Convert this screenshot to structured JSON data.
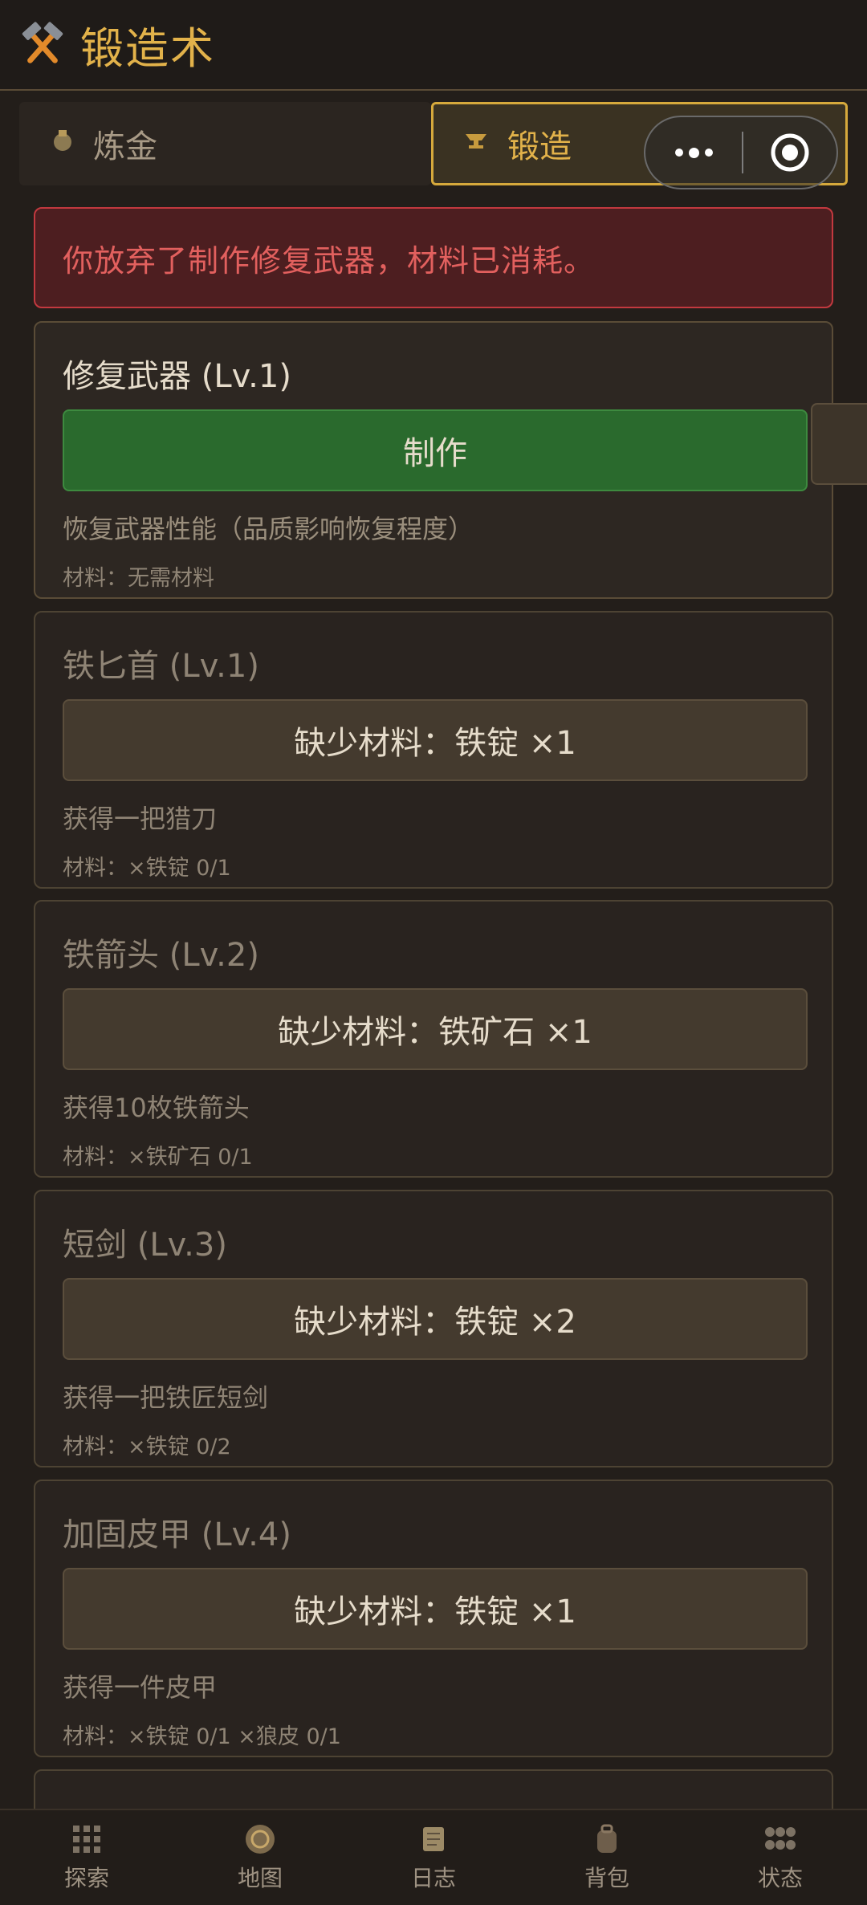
{
  "header": {
    "title": "锻造术",
    "logo_icon": "crossed-hammers-icon"
  },
  "tabs": [
    {
      "label": "炼金",
      "icon": "alchemy-icon",
      "active": false
    },
    {
      "label": "锻造",
      "icon": "anvil-icon",
      "active": true
    }
  ],
  "alert": {
    "text": "你放弃了制作修复武器，材料已消耗。"
  },
  "recipes": [
    {
      "title": "修复武器 (Lv.1)",
      "button": "制作",
      "desc": "恢复武器性能（品质影响恢复程度）",
      "materials": "材料：无需材料"
    },
    {
      "title": "铁匕首 (Lv.1)",
      "button": "缺少材料：铁锭 ×1",
      "desc": "获得一把猎刀",
      "materials": "材料：×铁锭 0/1"
    },
    {
      "title": "铁箭头 (Lv.2)",
      "button": "缺少材料：铁矿石 ×1",
      "desc": "获得10枚铁箭头",
      "materials": "材料：×铁矿石 0/1"
    },
    {
      "title": "短剑 (Lv.3)",
      "button": "缺少材料：铁锭 ×2",
      "desc": "获得一把铁匠短剑",
      "materials": "材料：×铁锭 0/2"
    },
    {
      "title": "加固皮甲 (Lv.4)",
      "button": "缺少材料：铁锭 ×1",
      "desc": "获得一件皮甲",
      "materials": "材料：×铁锭 0/1  ×狼皮 0/1"
    }
  ],
  "bottom_nav": [
    {
      "label": "探索",
      "icon": "explore-icon"
    },
    {
      "label": "地图",
      "icon": "map-icon"
    },
    {
      "label": "日志",
      "icon": "scroll-icon"
    },
    {
      "label": "背包",
      "icon": "backpack-icon"
    },
    {
      "label": "状态",
      "icon": "status-icon"
    }
  ],
  "colors": {
    "accent": "#e2b24a",
    "danger": "#c2393f",
    "craft": "#2a6a2d",
    "background": "#231e1a"
  }
}
